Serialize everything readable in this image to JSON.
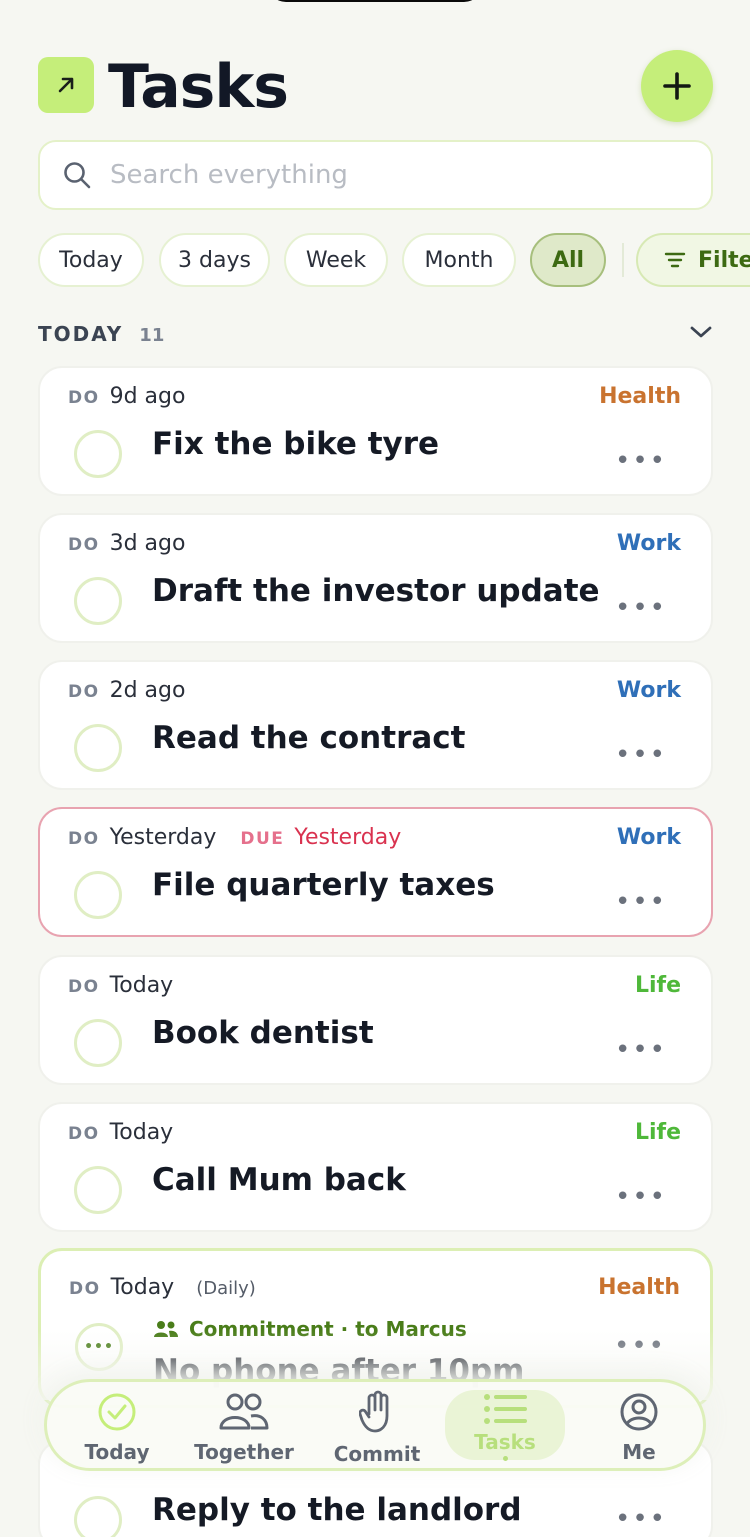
{
  "colors": {
    "accent": "#c5ee7a",
    "health": "#c9732f",
    "work": "#2f6fb8",
    "life": "#4fb83a",
    "overdue": "#d9324f"
  },
  "header": {
    "title": "Tasks"
  },
  "search": {
    "placeholder": "Search everything"
  },
  "filters": {
    "chips": [
      "Today",
      "3 days",
      "Week",
      "Month",
      "All"
    ],
    "active": "All",
    "filter_label": "Filter"
  },
  "section": {
    "label": "TODAY",
    "count": "11"
  },
  "tasks": [
    {
      "do_label": "DO",
      "when": "9d ago",
      "title": "Fix the bike tyre",
      "tag": "Health"
    },
    {
      "do_label": "DO",
      "when": "3d ago",
      "title": "Draft the investor update",
      "tag": "Work"
    },
    {
      "do_label": "DO",
      "when": "2d ago",
      "title": "Read the contract",
      "tag": "Work"
    },
    {
      "do_label": "DO",
      "when": "Yesterday",
      "due_label": "DUE",
      "due_when": "Yesterday",
      "title": "File quarterly taxes",
      "tag": "Work"
    },
    {
      "do_label": "DO",
      "when": "Today",
      "title": "Book dentist",
      "tag": "Life"
    },
    {
      "do_label": "DO",
      "when": "Today",
      "title": "Call Mum back",
      "tag": "Life"
    },
    {
      "do_label": "DO",
      "when": "Today",
      "recurrence": "(Daily)",
      "commitment": "Commitment · to Marcus",
      "title": "No phone after 10pm",
      "tag": "Health"
    },
    {
      "title": "Reply to the landlord"
    }
  ],
  "more_glyph": "•••",
  "nav": {
    "items": [
      "Today",
      "Together",
      "Commit",
      "Tasks",
      "Me"
    ],
    "active": "Tasks"
  }
}
